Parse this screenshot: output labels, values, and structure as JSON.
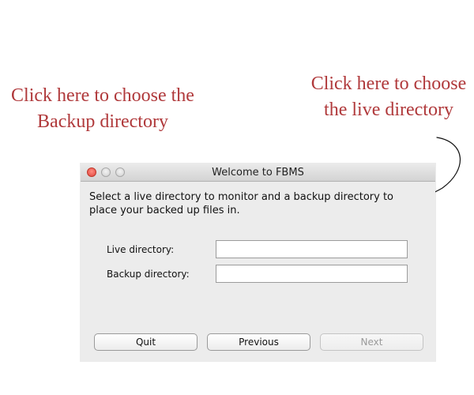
{
  "annotations": {
    "backup_callout": "Click here to choose the Backup directory",
    "live_callout": "Click here to choose the live directory",
    "callout_color": "#b0393b"
  },
  "window": {
    "title": "Welcome to FBMS",
    "instructions": "Select a live directory to monitor and a backup directory to place your backed up files in.",
    "live_label": "Live directory:",
    "live_value": "",
    "backup_label": "Backup directory:",
    "backup_value": "",
    "buttons": {
      "quit": "Quit",
      "previous": "Previous",
      "next": "Next",
      "next_enabled": false
    }
  }
}
